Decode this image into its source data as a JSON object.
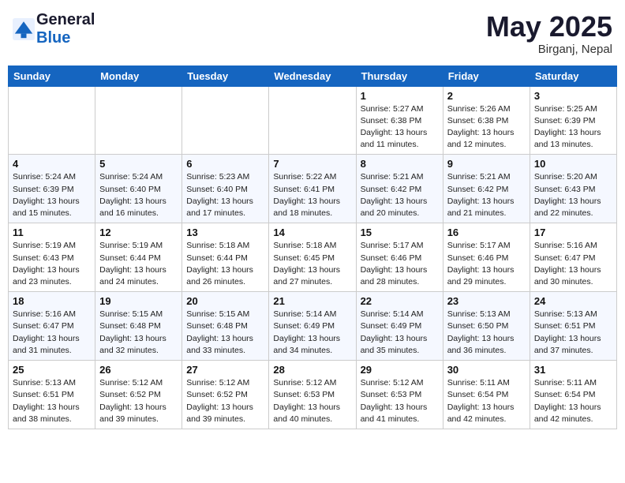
{
  "header": {
    "logo_general": "General",
    "logo_blue": "Blue",
    "month_title": "May 2025",
    "location": "Birganj, Nepal"
  },
  "days_of_week": [
    "Sunday",
    "Monday",
    "Tuesday",
    "Wednesday",
    "Thursday",
    "Friday",
    "Saturday"
  ],
  "weeks": [
    [
      {
        "day": "",
        "info": ""
      },
      {
        "day": "",
        "info": ""
      },
      {
        "day": "",
        "info": ""
      },
      {
        "day": "",
        "info": ""
      },
      {
        "day": "1",
        "sunrise": "5:27 AM",
        "sunset": "6:38 PM",
        "daylight": "13 hours and 11 minutes."
      },
      {
        "day": "2",
        "sunrise": "5:26 AM",
        "sunset": "6:38 PM",
        "daylight": "13 hours and 12 minutes."
      },
      {
        "day": "3",
        "sunrise": "5:25 AM",
        "sunset": "6:39 PM",
        "daylight": "13 hours and 13 minutes."
      }
    ],
    [
      {
        "day": "4",
        "sunrise": "5:24 AM",
        "sunset": "6:39 PM",
        "daylight": "13 hours and 15 minutes."
      },
      {
        "day": "5",
        "sunrise": "5:24 AM",
        "sunset": "6:40 PM",
        "daylight": "13 hours and 16 minutes."
      },
      {
        "day": "6",
        "sunrise": "5:23 AM",
        "sunset": "6:40 PM",
        "daylight": "13 hours and 17 minutes."
      },
      {
        "day": "7",
        "sunrise": "5:22 AM",
        "sunset": "6:41 PM",
        "daylight": "13 hours and 18 minutes."
      },
      {
        "day": "8",
        "sunrise": "5:21 AM",
        "sunset": "6:42 PM",
        "daylight": "13 hours and 20 minutes."
      },
      {
        "day": "9",
        "sunrise": "5:21 AM",
        "sunset": "6:42 PM",
        "daylight": "13 hours and 21 minutes."
      },
      {
        "day": "10",
        "sunrise": "5:20 AM",
        "sunset": "6:43 PM",
        "daylight": "13 hours and 22 minutes."
      }
    ],
    [
      {
        "day": "11",
        "sunrise": "5:19 AM",
        "sunset": "6:43 PM",
        "daylight": "13 hours and 23 minutes."
      },
      {
        "day": "12",
        "sunrise": "5:19 AM",
        "sunset": "6:44 PM",
        "daylight": "13 hours and 24 minutes."
      },
      {
        "day": "13",
        "sunrise": "5:18 AM",
        "sunset": "6:44 PM",
        "daylight": "13 hours and 26 minutes."
      },
      {
        "day": "14",
        "sunrise": "5:18 AM",
        "sunset": "6:45 PM",
        "daylight": "13 hours and 27 minutes."
      },
      {
        "day": "15",
        "sunrise": "5:17 AM",
        "sunset": "6:46 PM",
        "daylight": "13 hours and 28 minutes."
      },
      {
        "day": "16",
        "sunrise": "5:17 AM",
        "sunset": "6:46 PM",
        "daylight": "13 hours and 29 minutes."
      },
      {
        "day": "17",
        "sunrise": "5:16 AM",
        "sunset": "6:47 PM",
        "daylight": "13 hours and 30 minutes."
      }
    ],
    [
      {
        "day": "18",
        "sunrise": "5:16 AM",
        "sunset": "6:47 PM",
        "daylight": "13 hours and 31 minutes."
      },
      {
        "day": "19",
        "sunrise": "5:15 AM",
        "sunset": "6:48 PM",
        "daylight": "13 hours and 32 minutes."
      },
      {
        "day": "20",
        "sunrise": "5:15 AM",
        "sunset": "6:48 PM",
        "daylight": "13 hours and 33 minutes."
      },
      {
        "day": "21",
        "sunrise": "5:14 AM",
        "sunset": "6:49 PM",
        "daylight": "13 hours and 34 minutes."
      },
      {
        "day": "22",
        "sunrise": "5:14 AM",
        "sunset": "6:49 PM",
        "daylight": "13 hours and 35 minutes."
      },
      {
        "day": "23",
        "sunrise": "5:13 AM",
        "sunset": "6:50 PM",
        "daylight": "13 hours and 36 minutes."
      },
      {
        "day": "24",
        "sunrise": "5:13 AM",
        "sunset": "6:51 PM",
        "daylight": "13 hours and 37 minutes."
      }
    ],
    [
      {
        "day": "25",
        "sunrise": "5:13 AM",
        "sunset": "6:51 PM",
        "daylight": "13 hours and 38 minutes."
      },
      {
        "day": "26",
        "sunrise": "5:12 AM",
        "sunset": "6:52 PM",
        "daylight": "13 hours and 39 minutes."
      },
      {
        "day": "27",
        "sunrise": "5:12 AM",
        "sunset": "6:52 PM",
        "daylight": "13 hours and 39 minutes."
      },
      {
        "day": "28",
        "sunrise": "5:12 AM",
        "sunset": "6:53 PM",
        "daylight": "13 hours and 40 minutes."
      },
      {
        "day": "29",
        "sunrise": "5:12 AM",
        "sunset": "6:53 PM",
        "daylight": "13 hours and 41 minutes."
      },
      {
        "day": "30",
        "sunrise": "5:11 AM",
        "sunset": "6:54 PM",
        "daylight": "13 hours and 42 minutes."
      },
      {
        "day": "31",
        "sunrise": "5:11 AM",
        "sunset": "6:54 PM",
        "daylight": "13 hours and 42 minutes."
      }
    ]
  ]
}
